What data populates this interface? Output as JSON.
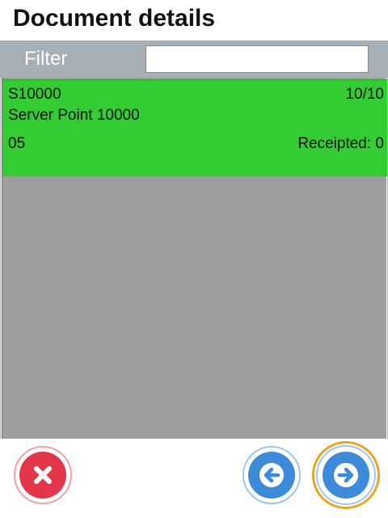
{
  "header": {
    "title": "Document details"
  },
  "filter": {
    "label": "Filter",
    "value": ""
  },
  "list": {
    "items": [
      {
        "code": "S10000",
        "count": "10/10",
        "name": "Server Point 10000",
        "number": "05",
        "receipted": "Receipted: 0",
        "color": "#33cc33"
      }
    ]
  },
  "footer": {
    "cancel_icon": "close-icon",
    "back_icon": "arrow-left-icon",
    "next_icon": "arrow-right-icon"
  }
}
